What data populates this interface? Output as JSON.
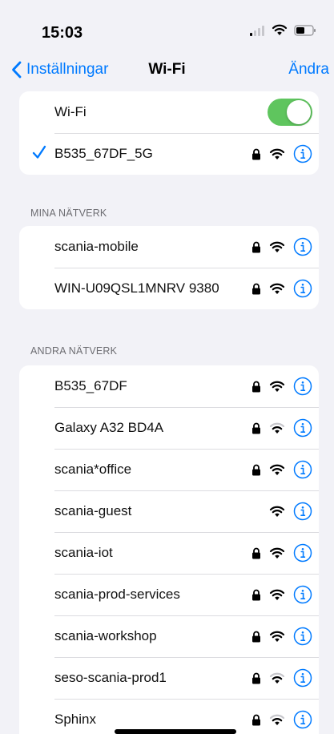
{
  "status": {
    "time": "15:03"
  },
  "nav": {
    "back_label": "Inställningar",
    "title": "Wi-Fi",
    "edit_label": "Ändra"
  },
  "wifi": {
    "toggle_label": "Wi-Fi",
    "toggle_on": true,
    "connected": {
      "name": "B535_67DF_5G",
      "locked": true
    }
  },
  "my_networks": {
    "header": "MINA NÄTVERK",
    "items": [
      {
        "name": "scania-mobile",
        "locked": true
      },
      {
        "name": "WIN-U09QSL1MNRV 9380",
        "locked": true
      }
    ]
  },
  "other_networks": {
    "header": "ANDRA NÄTVERK",
    "items": [
      {
        "name": "B535_67DF",
        "locked": true,
        "signal": 3
      },
      {
        "name": "Galaxy A32 BD4A",
        "locked": true,
        "signal": 2
      },
      {
        "name": "scania*office",
        "locked": true,
        "signal": 3
      },
      {
        "name": "scania-guest",
        "locked": false,
        "signal": 3
      },
      {
        "name": "scania-iot",
        "locked": true,
        "signal": 3
      },
      {
        "name": "scania-prod-services",
        "locked": true,
        "signal": 3
      },
      {
        "name": "scania-workshop",
        "locked": true,
        "signal": 3
      },
      {
        "name": "seso-scania-prod1",
        "locked": true,
        "signal": 2
      },
      {
        "name": "Sphinx",
        "locked": true,
        "signal": 2
      }
    ]
  },
  "colors": {
    "accent": "#007aff",
    "toggle_on": "#5fc55e",
    "background": "#f2f2f7"
  },
  "icons": {
    "lock": "lock-icon",
    "wifi": "wifi-icon",
    "info": "info-icon",
    "check": "checkmark-icon",
    "back": "chevron-left-icon"
  }
}
